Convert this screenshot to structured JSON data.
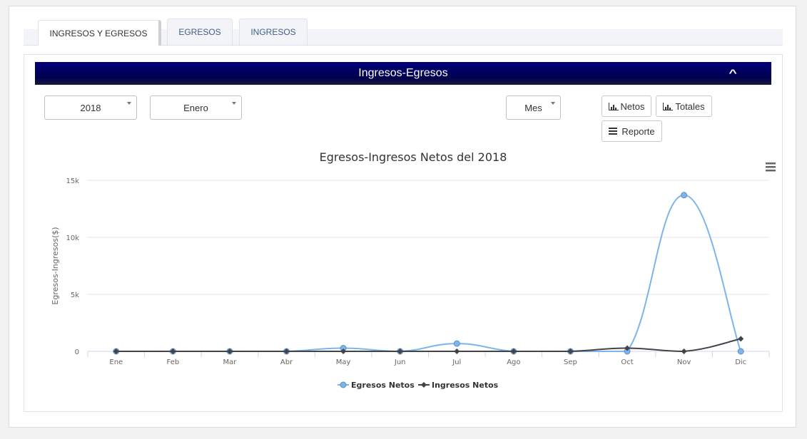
{
  "tabs": [
    {
      "label": "INGRESOS Y EGRESOS",
      "active": true
    },
    {
      "label": "EGRESOS",
      "active": false
    },
    {
      "label": "INGRESOS",
      "active": false
    }
  ],
  "panel": {
    "title": "Ingresos-Egresos",
    "collapse_icon": "chevron-up-icon"
  },
  "filters": {
    "year": "2018",
    "month": "Enero",
    "period": "Mes"
  },
  "buttons": {
    "netos": "Netos",
    "totales": "Totales",
    "reporte": "Reporte"
  },
  "colors": {
    "banner": "#000066",
    "egresos": "#7cb5ec",
    "ingresos": "#434348"
  },
  "chart_data": {
    "type": "line",
    "title": "Egresos-Ingresos Netos del 2018",
    "ylabel": "Egresos-Ingresos($)",
    "xlabel": "",
    "ylim": [
      0,
      15000
    ],
    "yticks": [
      0,
      5000,
      10000,
      15000
    ],
    "ytick_labels": [
      "0",
      "5k",
      "10k",
      "15k"
    ],
    "categories": [
      "Ene",
      "Feb",
      "Mar",
      "Abr",
      "May",
      "Jun",
      "Jul",
      "Ago",
      "Sep",
      "Oct",
      "Nov",
      "Dic"
    ],
    "series": [
      {
        "name": "Egresos Netos",
        "color": "#7cb5ec",
        "marker": "circle",
        "values": [
          0,
          0,
          0,
          0,
          280,
          0,
          680,
          0,
          0,
          0,
          13700,
          0
        ]
      },
      {
        "name": "Ingresos Netos",
        "color": "#434348",
        "marker": "diamond",
        "values": [
          0,
          0,
          0,
          0,
          0,
          0,
          0,
          0,
          0,
          280,
          0,
          1100
        ]
      }
    ],
    "grid": true,
    "legend": "bottom-center",
    "menu_icon": "hamburger-menu-icon"
  }
}
